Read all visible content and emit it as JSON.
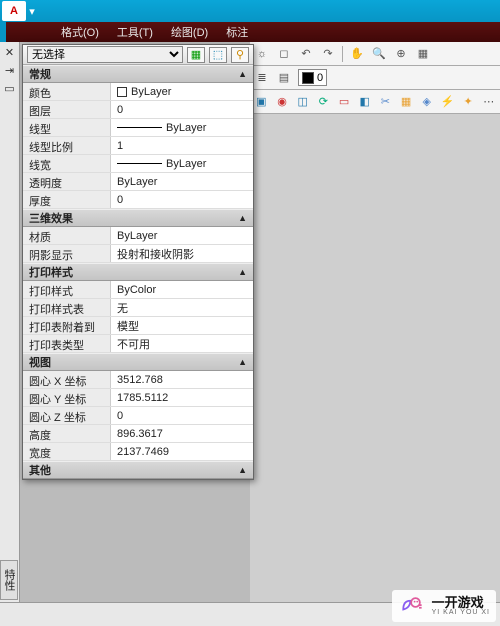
{
  "app": {
    "brand": "A",
    "title_partial": ""
  },
  "menu": {
    "format": "格式(O)",
    "tools": "工具(T)",
    "draw": "绘图(D)",
    "dim": "标注"
  },
  "toolbar": {
    "layer_name": "0"
  },
  "props": {
    "selector": "无选择",
    "sections": {
      "general": {
        "title": "常规",
        "rows": {
          "color": {
            "k": "颜色",
            "v": "ByLayer",
            "swatch": "#ffffff"
          },
          "layer": {
            "k": "图层",
            "v": "0"
          },
          "linetype": {
            "k": "线型",
            "v": "ByLayer",
            "line": true
          },
          "ltscale": {
            "k": "线型比例",
            "v": "1"
          },
          "lineweight": {
            "k": "线宽",
            "v": "ByLayer",
            "line": true
          },
          "transparency": {
            "k": "透明度",
            "v": "ByLayer"
          },
          "thickness": {
            "k": "厚度",
            "v": "0"
          }
        }
      },
      "threed": {
        "title": "三维效果",
        "rows": {
          "material": {
            "k": "材质",
            "v": "ByLayer"
          },
          "shadow": {
            "k": "阴影显示",
            "v": "投射和接收阴影"
          }
        }
      },
      "plotstyle": {
        "title": "打印样式",
        "rows": {
          "pstyle": {
            "k": "打印样式",
            "v": "ByColor"
          },
          "ptable": {
            "k": "打印样式表",
            "v": "无"
          },
          "pattach": {
            "k": "打印表附着到",
            "v": "模型"
          },
          "ptype": {
            "k": "打印表类型",
            "v": "不可用"
          }
        }
      },
      "view": {
        "title": "视图",
        "rows": {
          "cx": {
            "k": "圆心 X 坐标",
            "v": "3512.768"
          },
          "cy": {
            "k": "圆心 Y 坐标",
            "v": "1785.5112"
          },
          "cz": {
            "k": "圆心 Z 坐标",
            "v": "0"
          },
          "height": {
            "k": "高度",
            "v": "896.3617"
          },
          "width": {
            "k": "宽度",
            "v": "2137.7469"
          }
        }
      },
      "other": {
        "title": "其他"
      }
    }
  },
  "sidebar": {
    "tab": "特性"
  },
  "watermark": {
    "cn": "一开游戏",
    "en": "YI KAI YOU XI"
  }
}
